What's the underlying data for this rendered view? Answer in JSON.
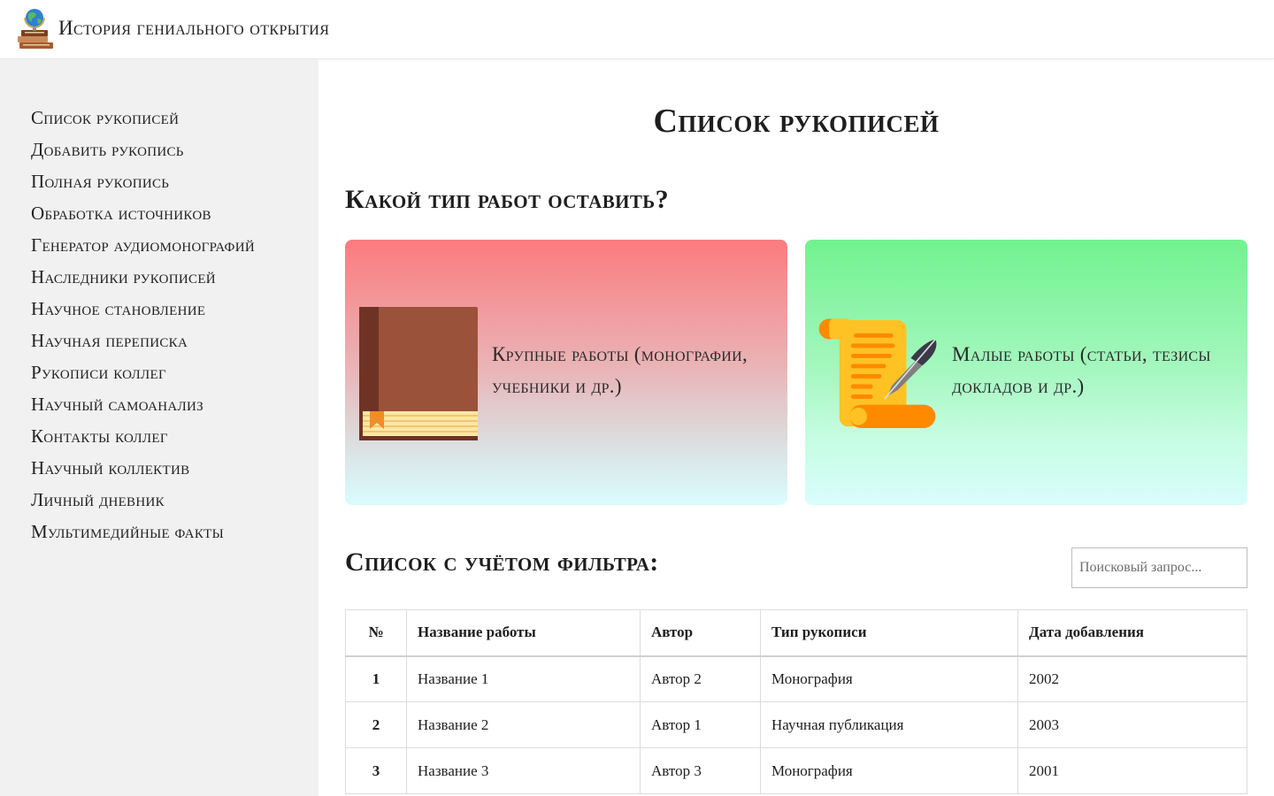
{
  "header": {
    "site_title": "История гениального открытия",
    "logo_icon": "globe-books-icon"
  },
  "sidebar": {
    "items": [
      {
        "label": "Список рукописей"
      },
      {
        "label": "Добавить рукопись"
      },
      {
        "label": "Полная рукопись"
      },
      {
        "label": "Обработка источников"
      },
      {
        "label": "Генератор аудиомонографий"
      },
      {
        "label": "Наследники рукописей"
      },
      {
        "label": "Научное становление"
      },
      {
        "label": "Научная переписка"
      },
      {
        "label": "Рукописи коллег"
      },
      {
        "label": "Научный самоанализ"
      },
      {
        "label": "Контакты коллег"
      },
      {
        "label": "Научный коллектив"
      },
      {
        "label": "Личный дневник"
      },
      {
        "label": "Мультимедийные факты"
      }
    ]
  },
  "main": {
    "page_title": "Список рукописей",
    "type_question": "Какой тип работ оставить?",
    "cards": {
      "big": {
        "label": "Крупные работы (монографии, учебники и др.)",
        "icon": "book-icon",
        "gradient": [
          "#fb7b7e",
          "#d9fdff"
        ]
      },
      "small": {
        "label": "Малые работы (статьи, тезисы докладов и др.)",
        "icon": "scroll-quill-icon",
        "gradient": [
          "#72f28f",
          "#d9fdfc"
        ]
      }
    },
    "filter_title": "Список с учётом фильтра:",
    "search": {
      "placeholder": "Поисковый запрос...",
      "value": ""
    },
    "table": {
      "headers": [
        "№",
        "Название работы",
        "Автор",
        "Тип рукописи",
        "Дата добавления"
      ],
      "rows": [
        [
          "1",
          "Название 1",
          "Автор 2",
          "Монография",
          "2002"
        ],
        [
          "2",
          "Название 2",
          "Автор 1",
          "Научная публикация",
          "2003"
        ],
        [
          "3",
          "Название 3",
          "Автор 3",
          "Монография",
          "2001"
        ]
      ]
    }
  }
}
